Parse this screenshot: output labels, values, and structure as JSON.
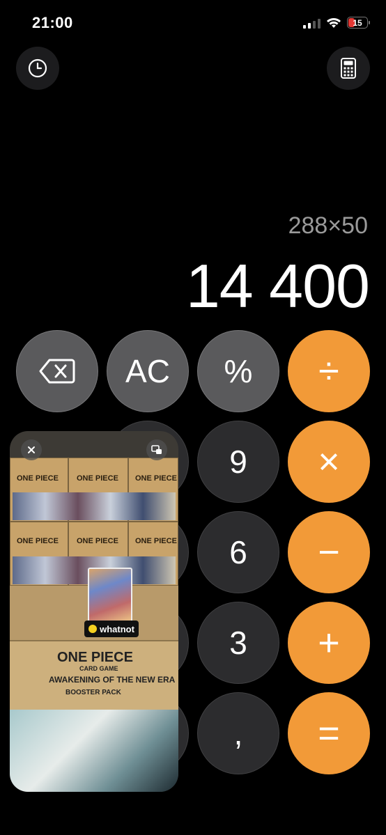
{
  "status": {
    "time": "21:00",
    "battery": "15"
  },
  "toolbar": {
    "history_icon": "clock-icon",
    "mode_icon": "calculator-icon"
  },
  "display": {
    "expression": "288×50",
    "result": "14 400"
  },
  "keys": {
    "backspace_icon": "backspace-icon",
    "ac": "AC",
    "percent": "%",
    "divide": "÷",
    "nine": "9",
    "multiply": "×",
    "six": "6",
    "minus": "−",
    "three": "3",
    "plus": "+",
    "comma": ",",
    "equals": "="
  },
  "pip": {
    "brand": "whatnot",
    "box_title": "ONE PIECE",
    "box_subtitle": "CARD GAME",
    "box_set": "AWAKENING OF THE NEW ERA",
    "box_type": "BOOSTER PACK",
    "shelf_label": "ONE PIECE",
    "close_icon": "close-icon",
    "expand_icon": "pip-restore-icon"
  },
  "colors": {
    "operator": "#f29a38",
    "function": "#5a5a5c",
    "digit": "#2c2c2e"
  }
}
